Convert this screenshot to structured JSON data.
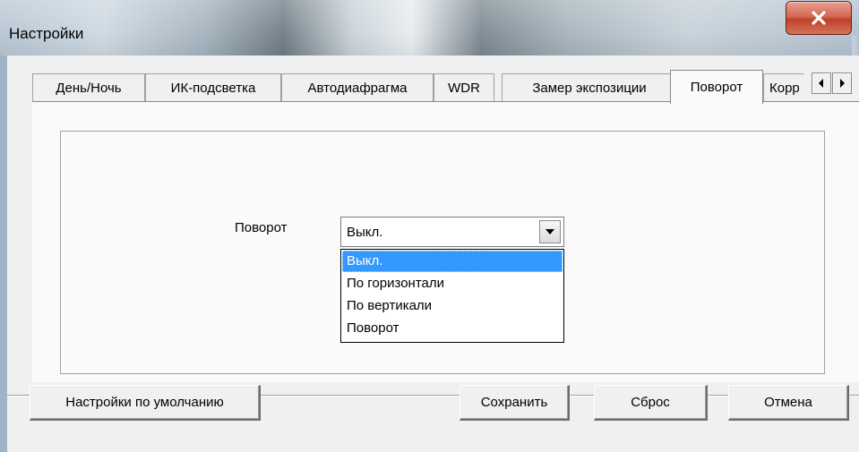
{
  "window": {
    "title": "Настройки",
    "close_icon": "close-x-icon",
    "close_color": "#c7432c"
  },
  "tabs": [
    {
      "label": "День/Ночь",
      "active": false
    },
    {
      "label": "ИК-подсветка",
      "active": false
    },
    {
      "label": "Автодиафрагма",
      "active": false
    },
    {
      "label": "WDR",
      "active": false
    },
    {
      "label": "Замер экспозиции",
      "active": false
    },
    {
      "label": "Поворот",
      "active": true
    },
    {
      "label": "Корр",
      "active": false
    }
  ],
  "tab_scroll": {
    "left_icon": "arrow-left-icon",
    "right_icon": "arrow-right-icon"
  },
  "rotation": {
    "label": "Поворот",
    "value": "Выкл.",
    "options": [
      "Выкл.",
      "По горизонтали",
      "По вертикали",
      "Поворот"
    ],
    "selected_index": 0,
    "highlight_color": "#3399ff"
  },
  "footer": {
    "defaults_label": "Настройки по умолчанию",
    "save_label": "Сохранить",
    "reset_label": "Сброс",
    "cancel_label": "Отмена"
  }
}
